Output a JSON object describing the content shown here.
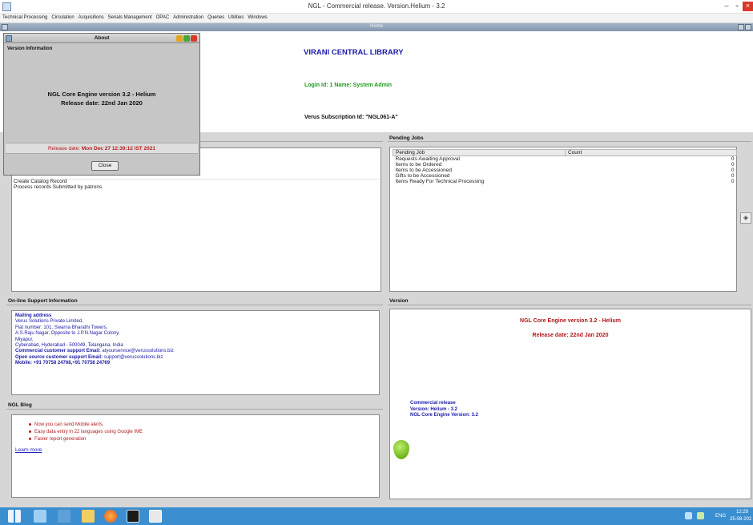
{
  "window": {
    "title": "NGL - Commercial release. Version.Helium - 3.2",
    "minimize_symbol": "–",
    "maximize_symbol": "▫",
    "close_symbol": "×"
  },
  "menu": [
    "Technical Processing",
    "Circulation",
    "Acquisitions",
    "Serials Management",
    "OPAC",
    "Administration",
    "Queries",
    "Utilities",
    "Windows"
  ],
  "frame": {
    "title": "Home"
  },
  "header": {
    "library": "VIRANI CENTRAL LIBRARY",
    "login": "Login Id: 1    Name: System Admin",
    "subscription": "Verus Subscription Id: \"NGL061-A\""
  },
  "left_tasks": {
    "items": [
      "Create Catalog Record",
      "Process records Submitted by patrons"
    ]
  },
  "pending": {
    "label": "Pending Jobs",
    "columns": [
      "Pending Job",
      "Count"
    ],
    "rows": [
      {
        "job": "Requests Awaiting Approval",
        "count": "0"
      },
      {
        "job": "Items to be Ordered",
        "count": "0"
      },
      {
        "job": "Items to be Accessioned",
        "count": "0"
      },
      {
        "job": "Gifts to be Accessioned",
        "count": "0"
      },
      {
        "job": "Items Ready For Technical Processing",
        "count": "0"
      }
    ]
  },
  "support": {
    "label": "On-line Support Information",
    "heading": "Mailing address",
    "lines": [
      "Verus Solutions Private Limited,",
      "Flat number: 101, Swarna Bharathi Towers,",
      "A.S.Raju Nagar, Opposite to J.P.N.Nagar Colony,",
      "Miyapur,",
      "Cyberabad, Hyderabad - 500049, Telangana, India"
    ],
    "commercial_label": "Commercial customer support Email:",
    "commercial_email": "atyourservice@verussolutions.biz",
    "open_label": "Open source customer support Email:",
    "open_email": "support@verussolutions.biz",
    "mobile": "Mobile: +91 70758 24768,+91 70758 24769"
  },
  "blog": {
    "label": "NGL Blog",
    "items": [
      "Now you can send Mobile alerts.",
      "Easy data entry in 22 languages using Google IME",
      "Faster report generation"
    ],
    "link": "Learn more"
  },
  "version_panel": {
    "label": "Version",
    "engine": "NGL Core Engine version 3.2 - Helium",
    "release": "Release date: 22nd Jan 2020",
    "info": [
      "Commercial release",
      "Version: Helium - 3.2",
      "NGL Core Engine Version: 3.2"
    ]
  },
  "about": {
    "title": "About",
    "section": "Version Information",
    "engine": "NGL Core Engine version 3.2 - Helium",
    "release": "Release date: 22nd Jan 2020",
    "release_label": "Release date:",
    "release_value": "Mon Dec 27 12:39:12 IST 2021",
    "close": "Close"
  },
  "taskbar": {
    "lang": "ENG",
    "time": "12:29",
    "date": "25-08-202"
  },
  "colors": {
    "accent_blue": "#1c1ca8",
    "green": "#1d9c1d",
    "red": "#b51c1c",
    "taskbar": "#3b8fd0"
  },
  "icons": [
    "app-icon",
    "frame-icon",
    "restore-icon",
    "side-arrow-icon",
    "leaf-icon",
    "windows-start-icon",
    "file-explorer-icon",
    "tools-icon",
    "folder-icon",
    "firefox-icon",
    "terminal-icon",
    "java-icon",
    "tray-network-icon",
    "tray-volume-icon"
  ]
}
